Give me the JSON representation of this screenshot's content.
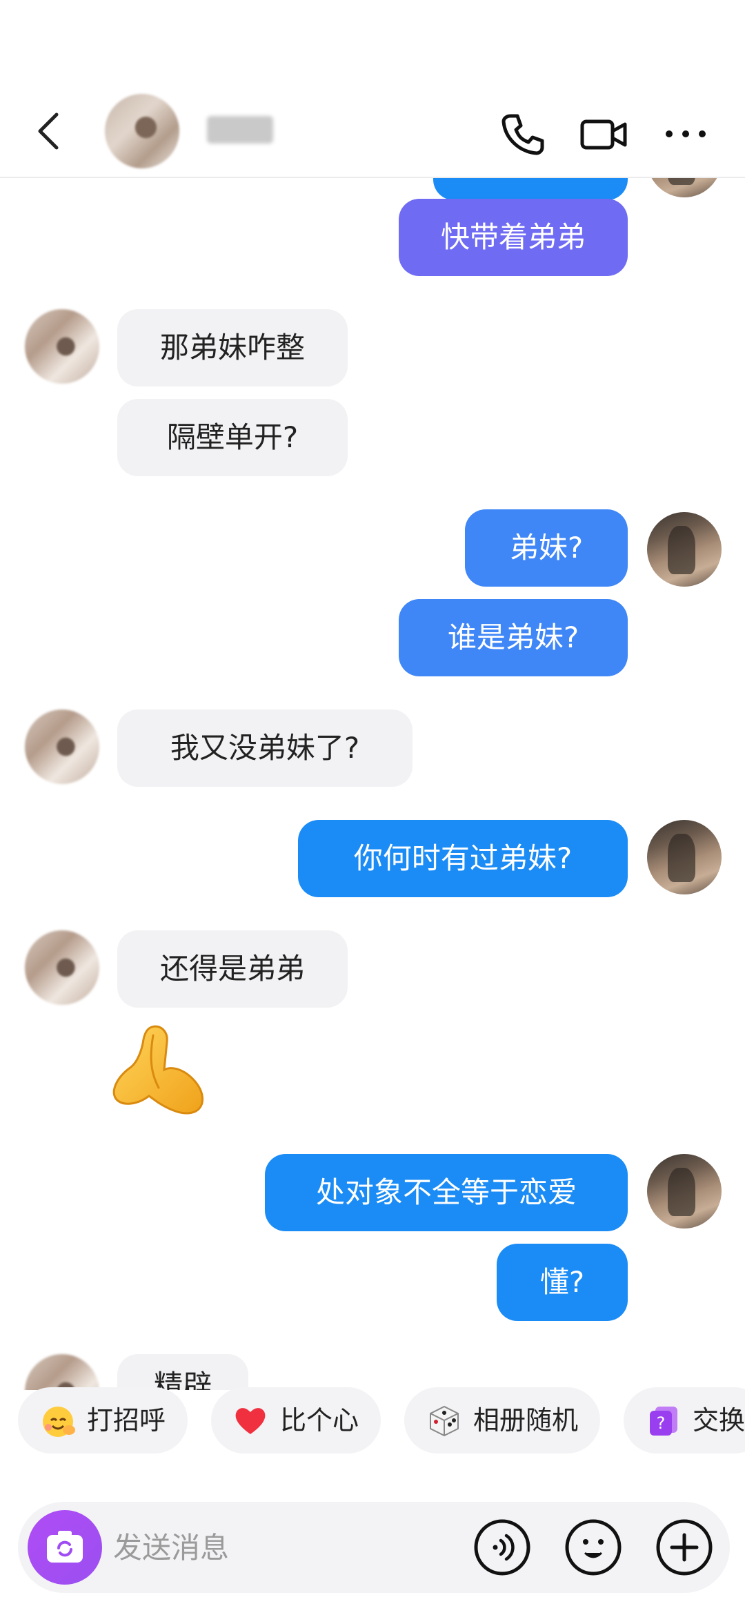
{
  "header": {
    "contact_name": "",
    "icons": [
      "back-arrow-icon",
      "phone-icon",
      "video-camera-icon",
      "more-dots-icon"
    ]
  },
  "messages": [
    {
      "side": "out",
      "text": "快带着弟弟"
    },
    {
      "side": "in",
      "text": "那弟妹咋整"
    },
    {
      "side": "in",
      "text": "隔壁单开?"
    },
    {
      "side": "out",
      "text": "弟妹?"
    },
    {
      "side": "out",
      "text": "谁是弟妹?"
    },
    {
      "side": "in",
      "text": "我又没弟妹了?"
    },
    {
      "side": "out",
      "text": "你何时有过弟妹?"
    },
    {
      "side": "in",
      "text": "还得是弟弟"
    },
    {
      "side": "in",
      "sticker": "praying-hands-emoji"
    },
    {
      "side": "out",
      "text": "处对象不全等于恋爱"
    },
    {
      "side": "out",
      "text": "懂?"
    },
    {
      "side": "in",
      "text": "精辟"
    }
  ],
  "quick_replies": [
    {
      "label": "打招呼",
      "icon": "waving-face-icon"
    },
    {
      "label": "比个心",
      "icon": "red-heart-icon"
    },
    {
      "label": "相册随机",
      "icon": "dice-icon"
    },
    {
      "label": "交换",
      "icon": "question-cards-icon"
    }
  ],
  "input": {
    "placeholder": "发送消息",
    "value": "",
    "icons": [
      "camera-icon",
      "voice-icon",
      "emoji-face-icon",
      "plus-icon"
    ]
  },
  "colors": {
    "bubble_in": "#f2f2f4",
    "bubble_out_purple": "#6f6bf3",
    "bubble_out_blue": "#3f86f7",
    "bubble_out_cyan": "#1b8cf5",
    "camera_button": "#9a4ff0"
  }
}
